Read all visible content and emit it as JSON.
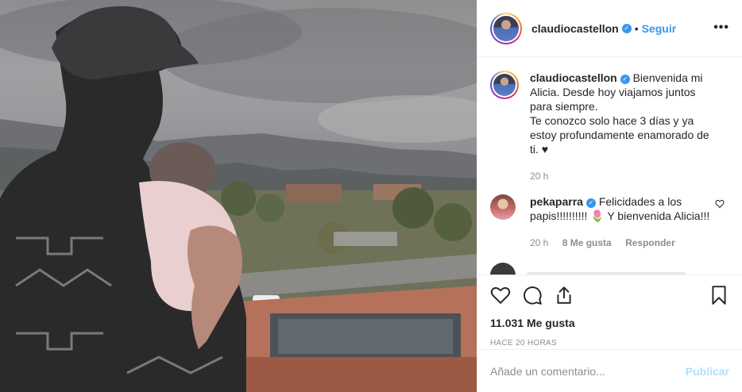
{
  "post": {
    "image_alt": "Man in cap holding a newborn baby by a window overlooking a city",
    "author": "claudiocastellon",
    "follow_label": "Seguir",
    "separator": "•",
    "more_label": "•••"
  },
  "caption": {
    "username": "claudiocastellon",
    "line1": "Bienvenida mi Alicia. Desde hoy viajamos juntos para siempre.",
    "line2": "Te conozco solo hace 3 días y ya estoy profundamente enamorado de ti. ♥",
    "age": "20 h"
  },
  "comments": [
    {
      "username": "pekaparra",
      "text": "Felicidades a los papis!!!!!!!!!! 🌷 Y bienvenida Alicia!!!",
      "age": "20 h",
      "likes": "8 Me gusta",
      "reply_label": "Responder"
    }
  ],
  "stats": {
    "likes": "11.031 Me gusta",
    "posted": "Hace 20 horas"
  },
  "composer": {
    "placeholder": "Añade un comentario...",
    "publish_label": "Publicar"
  },
  "icons": {
    "like": "heart-icon",
    "comment": "comment-icon",
    "share": "share-icon",
    "save": "bookmark-icon",
    "verified": "verified-badge-icon"
  },
  "colors": {
    "accent": "#3897f0",
    "publish_disabled": "#b2dffc",
    "muted": "#8e8e8e",
    "text": "#262626"
  }
}
